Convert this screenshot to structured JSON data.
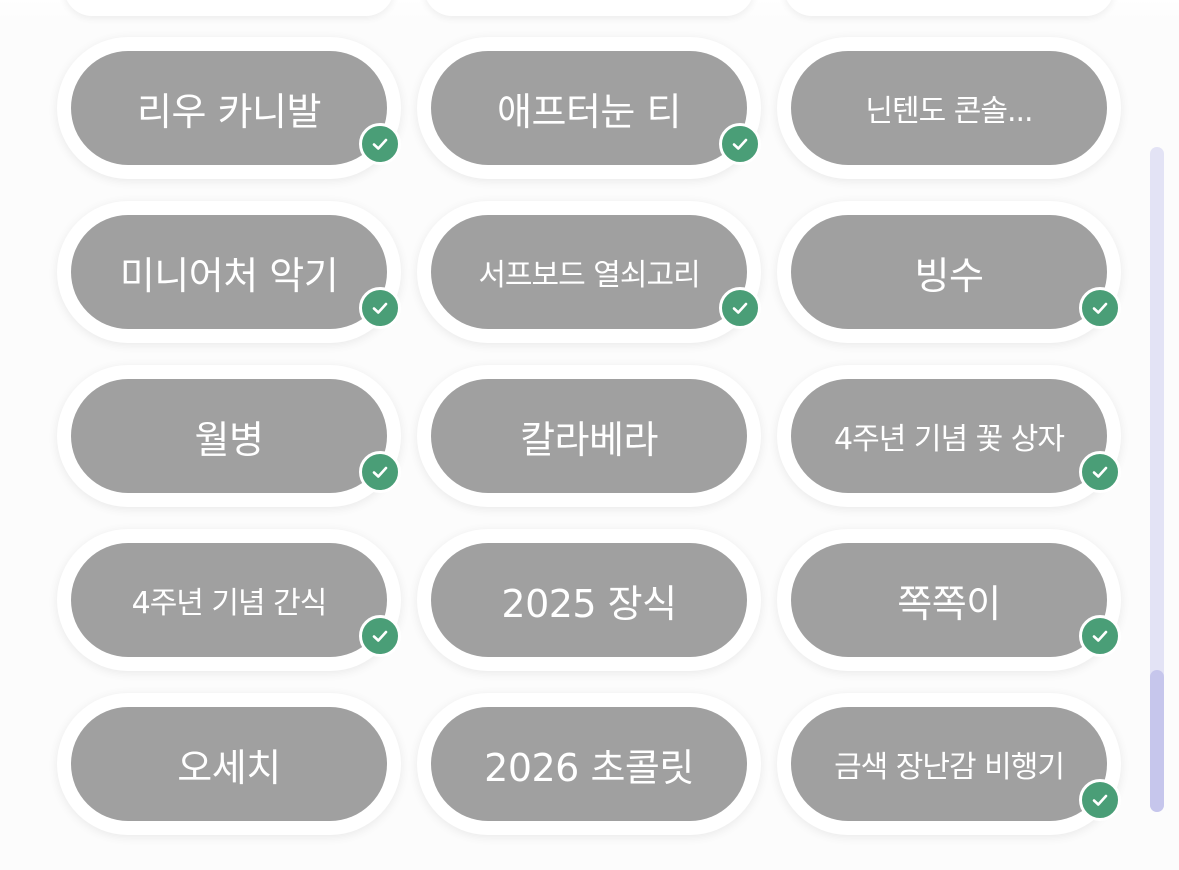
{
  "items": [
    {
      "label": "리우 카니발",
      "checked": true
    },
    {
      "label": "애프터눈 티",
      "checked": true
    },
    {
      "label": "닌텐도 콘솔...",
      "checked": false
    },
    {
      "label": "미니어처 악기",
      "checked": true
    },
    {
      "label": "서프보드 열쇠고리",
      "checked": true
    },
    {
      "label": "빙수",
      "checked": true
    },
    {
      "label": "월병",
      "checked": true
    },
    {
      "label": "칼라베라",
      "checked": false
    },
    {
      "label": "4주년 기념 꽃 상자",
      "checked": true
    },
    {
      "label": "4주년 기념 간식",
      "checked": true
    },
    {
      "label": "2025 장식",
      "checked": false
    },
    {
      "label": "쪽쪽이",
      "checked": true
    },
    {
      "label": "오세치",
      "checked": false
    },
    {
      "label": "2026 초콜릿",
      "checked": false
    },
    {
      "label": "금색 장난감 비행기",
      "checked": true
    }
  ],
  "colors": {
    "pill": "#a0a0a0",
    "check": "#4a9e77",
    "scrollbar_track": "#e3e3f5",
    "scrollbar_thumb": "#c6c6ec"
  },
  "icons": {
    "check": "check-icon"
  }
}
